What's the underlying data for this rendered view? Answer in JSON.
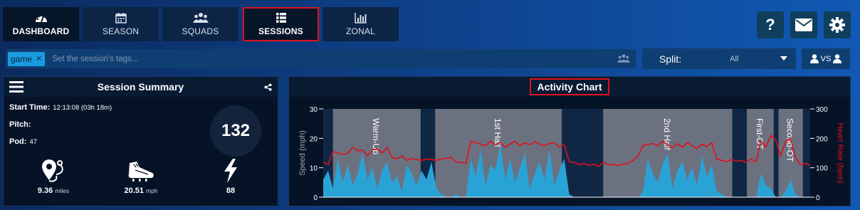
{
  "nav": {
    "tabs": [
      {
        "label": "DASHBOARD",
        "icon": "dashboard-icon"
      },
      {
        "label": "SEASON",
        "icon": "calendar-icon"
      },
      {
        "label": "SQUADS",
        "icon": "users-icon"
      },
      {
        "label": "SESSIONS",
        "icon": "list-icon"
      },
      {
        "label": "ZONAL",
        "icon": "bar-chart-icon"
      }
    ],
    "help_label": "?"
  },
  "tags": {
    "items": [
      "game"
    ],
    "remove_glyph": "✕",
    "placeholder": "Set the session's tags..."
  },
  "split": {
    "label": "Split:",
    "value": "All"
  },
  "compare": {
    "label": "VS"
  },
  "summary": {
    "title": "Session Summary",
    "start_time_label": "Start Time:",
    "start_time_value": "12:13:08 (03h 18m)",
    "pitch_label": "Pitch:",
    "pod_label": "Pod:",
    "pod_value": "47",
    "big_number": "132",
    "stats": [
      {
        "value": "9.36",
        "unit": "miles",
        "icon": "map-pin-icon"
      },
      {
        "value": "20.51",
        "unit": "mph",
        "icon": "boot-icon"
      },
      {
        "value": "88",
        "unit": "",
        "icon": "lightning-icon"
      }
    ]
  },
  "chart_data": {
    "type": "area",
    "title": "Activity Chart",
    "ylabel": "Speed (mph)",
    "ylabel_right": "Heart Rate (bpm)",
    "ylim": [
      0,
      30
    ],
    "ylim_right": [
      0,
      300
    ],
    "yticks": [
      "0",
      "10",
      "20",
      "30"
    ],
    "yticks_right": [
      "0",
      "100",
      "200",
      "300"
    ],
    "colors": {
      "speed": "#29a3d6",
      "heart_rate": "#e0101b",
      "period": "#6c7180",
      "bg": "#0f2745"
    },
    "periods": [
      {
        "label": "Warm-Up",
        "start": 0.02,
        "end": 0.2
      },
      {
        "label": "1st Half",
        "start": 0.23,
        "end": 0.49
      },
      {
        "label": "2nd Half",
        "start": 0.575,
        "end": 0.84
      },
      {
        "label": "First-OT",
        "start": 0.87,
        "end": 0.925
      },
      {
        "label": "Second-OT",
        "start": 0.935,
        "end": 0.985
      }
    ],
    "series": [
      {
        "name": "Speed (mph)",
        "values": [
          6,
          9,
          3,
          13,
          5,
          11,
          4,
          8,
          15,
          6,
          10,
          3,
          9,
          12,
          5,
          7,
          2,
          11,
          8,
          4,
          9,
          6,
          12,
          3,
          1,
          0,
          0,
          1,
          0,
          0,
          13,
          7,
          16,
          4,
          11,
          9,
          18,
          6,
          13,
          5,
          10,
          15,
          3,
          8,
          12,
          6,
          16,
          4,
          9,
          13,
          1,
          0,
          0,
          0,
          0,
          0,
          0,
          0,
          0,
          0,
          0,
          0,
          0,
          0,
          0,
          2,
          13,
          8,
          5,
          11,
          15,
          3,
          9,
          12,
          6,
          10,
          4,
          14,
          7,
          11,
          2,
          1,
          0,
          0,
          0,
          0,
          0,
          0,
          0,
          8,
          4,
          3,
          0,
          0,
          2,
          6,
          1,
          0,
          0,
          0
        ]
      },
      {
        "name": "Heart Rate (bpm)",
        "values": [
          120,
          110,
          155,
          150,
          145,
          150,
          170,
          158,
          160,
          140,
          160,
          165,
          150,
          170,
          135,
          130,
          140,
          125,
          132,
          128,
          125,
          130,
          128,
          125,
          130,
          132,
          135,
          120,
          118,
          115,
          190,
          185,
          180,
          175,
          190,
          178,
          185,
          170,
          180,
          190,
          175,
          185,
          178,
          188,
          180,
          175,
          182,
          185,
          170,
          178,
          120,
          118,
          110,
          115,
          108,
          112,
          105,
          118,
          110,
          112,
          108,
          112,
          115,
          125,
          140,
          175,
          180,
          182,
          175,
          190,
          178,
          168,
          182,
          170,
          185,
          175,
          165,
          180,
          172,
          185,
          130,
          125,
          120,
          128,
          122,
          125,
          118,
          130,
          120,
          190,
          170,
          210,
          195,
          140,
          190,
          200,
          135,
          110,
          115,
          108
        ]
      }
    ]
  }
}
